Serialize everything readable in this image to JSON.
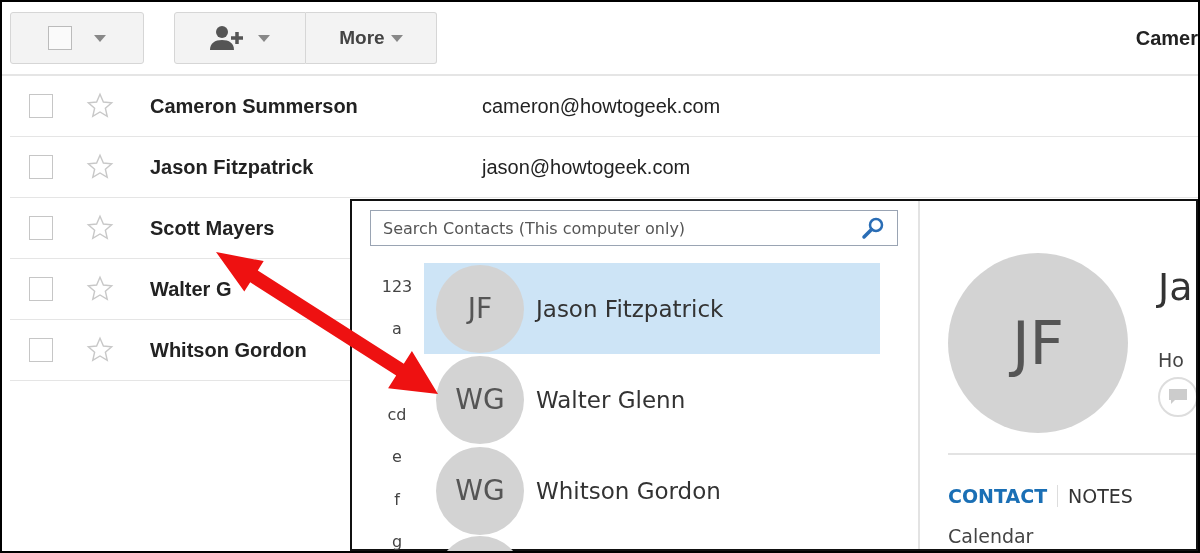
{
  "toolbar": {
    "more_label": "More",
    "account_name": "Camer"
  },
  "contacts": [
    {
      "name": "Cameron Summerson",
      "email": "cameron@howtogeek.com",
      "checked": false,
      "starred": false
    },
    {
      "name": "Jason Fitzpatrick",
      "email": "jason@howtogeek.com",
      "checked": false,
      "starred": false
    },
    {
      "name": "Scott Mayers",
      "checked": false,
      "starred": false
    },
    {
      "name": "Walter G",
      "checked": false,
      "starred": false
    },
    {
      "name": "Whitson Gordon",
      "checked": false,
      "starred": false
    }
  ],
  "people_window": {
    "search": {
      "placeholder": "Search Contacts (This computer only)"
    },
    "index": [
      "123",
      "a",
      "cd",
      "e",
      "f",
      "g"
    ],
    "list": [
      {
        "initials": "JF",
        "name": "Jason Fitzpatrick",
        "selected": true
      },
      {
        "initials": "WG",
        "name": "Walter Glenn",
        "selected": false
      },
      {
        "initials": "WG",
        "name": "Whitson Gordon",
        "selected": false
      }
    ],
    "detail": {
      "initials": "JF",
      "name": "Ja",
      "company": "Ho",
      "tabs": [
        {
          "label": "CONTACT",
          "selected": true
        },
        {
          "label": "NOTES",
          "selected": false
        }
      ],
      "section": "Calendar"
    }
  }
}
